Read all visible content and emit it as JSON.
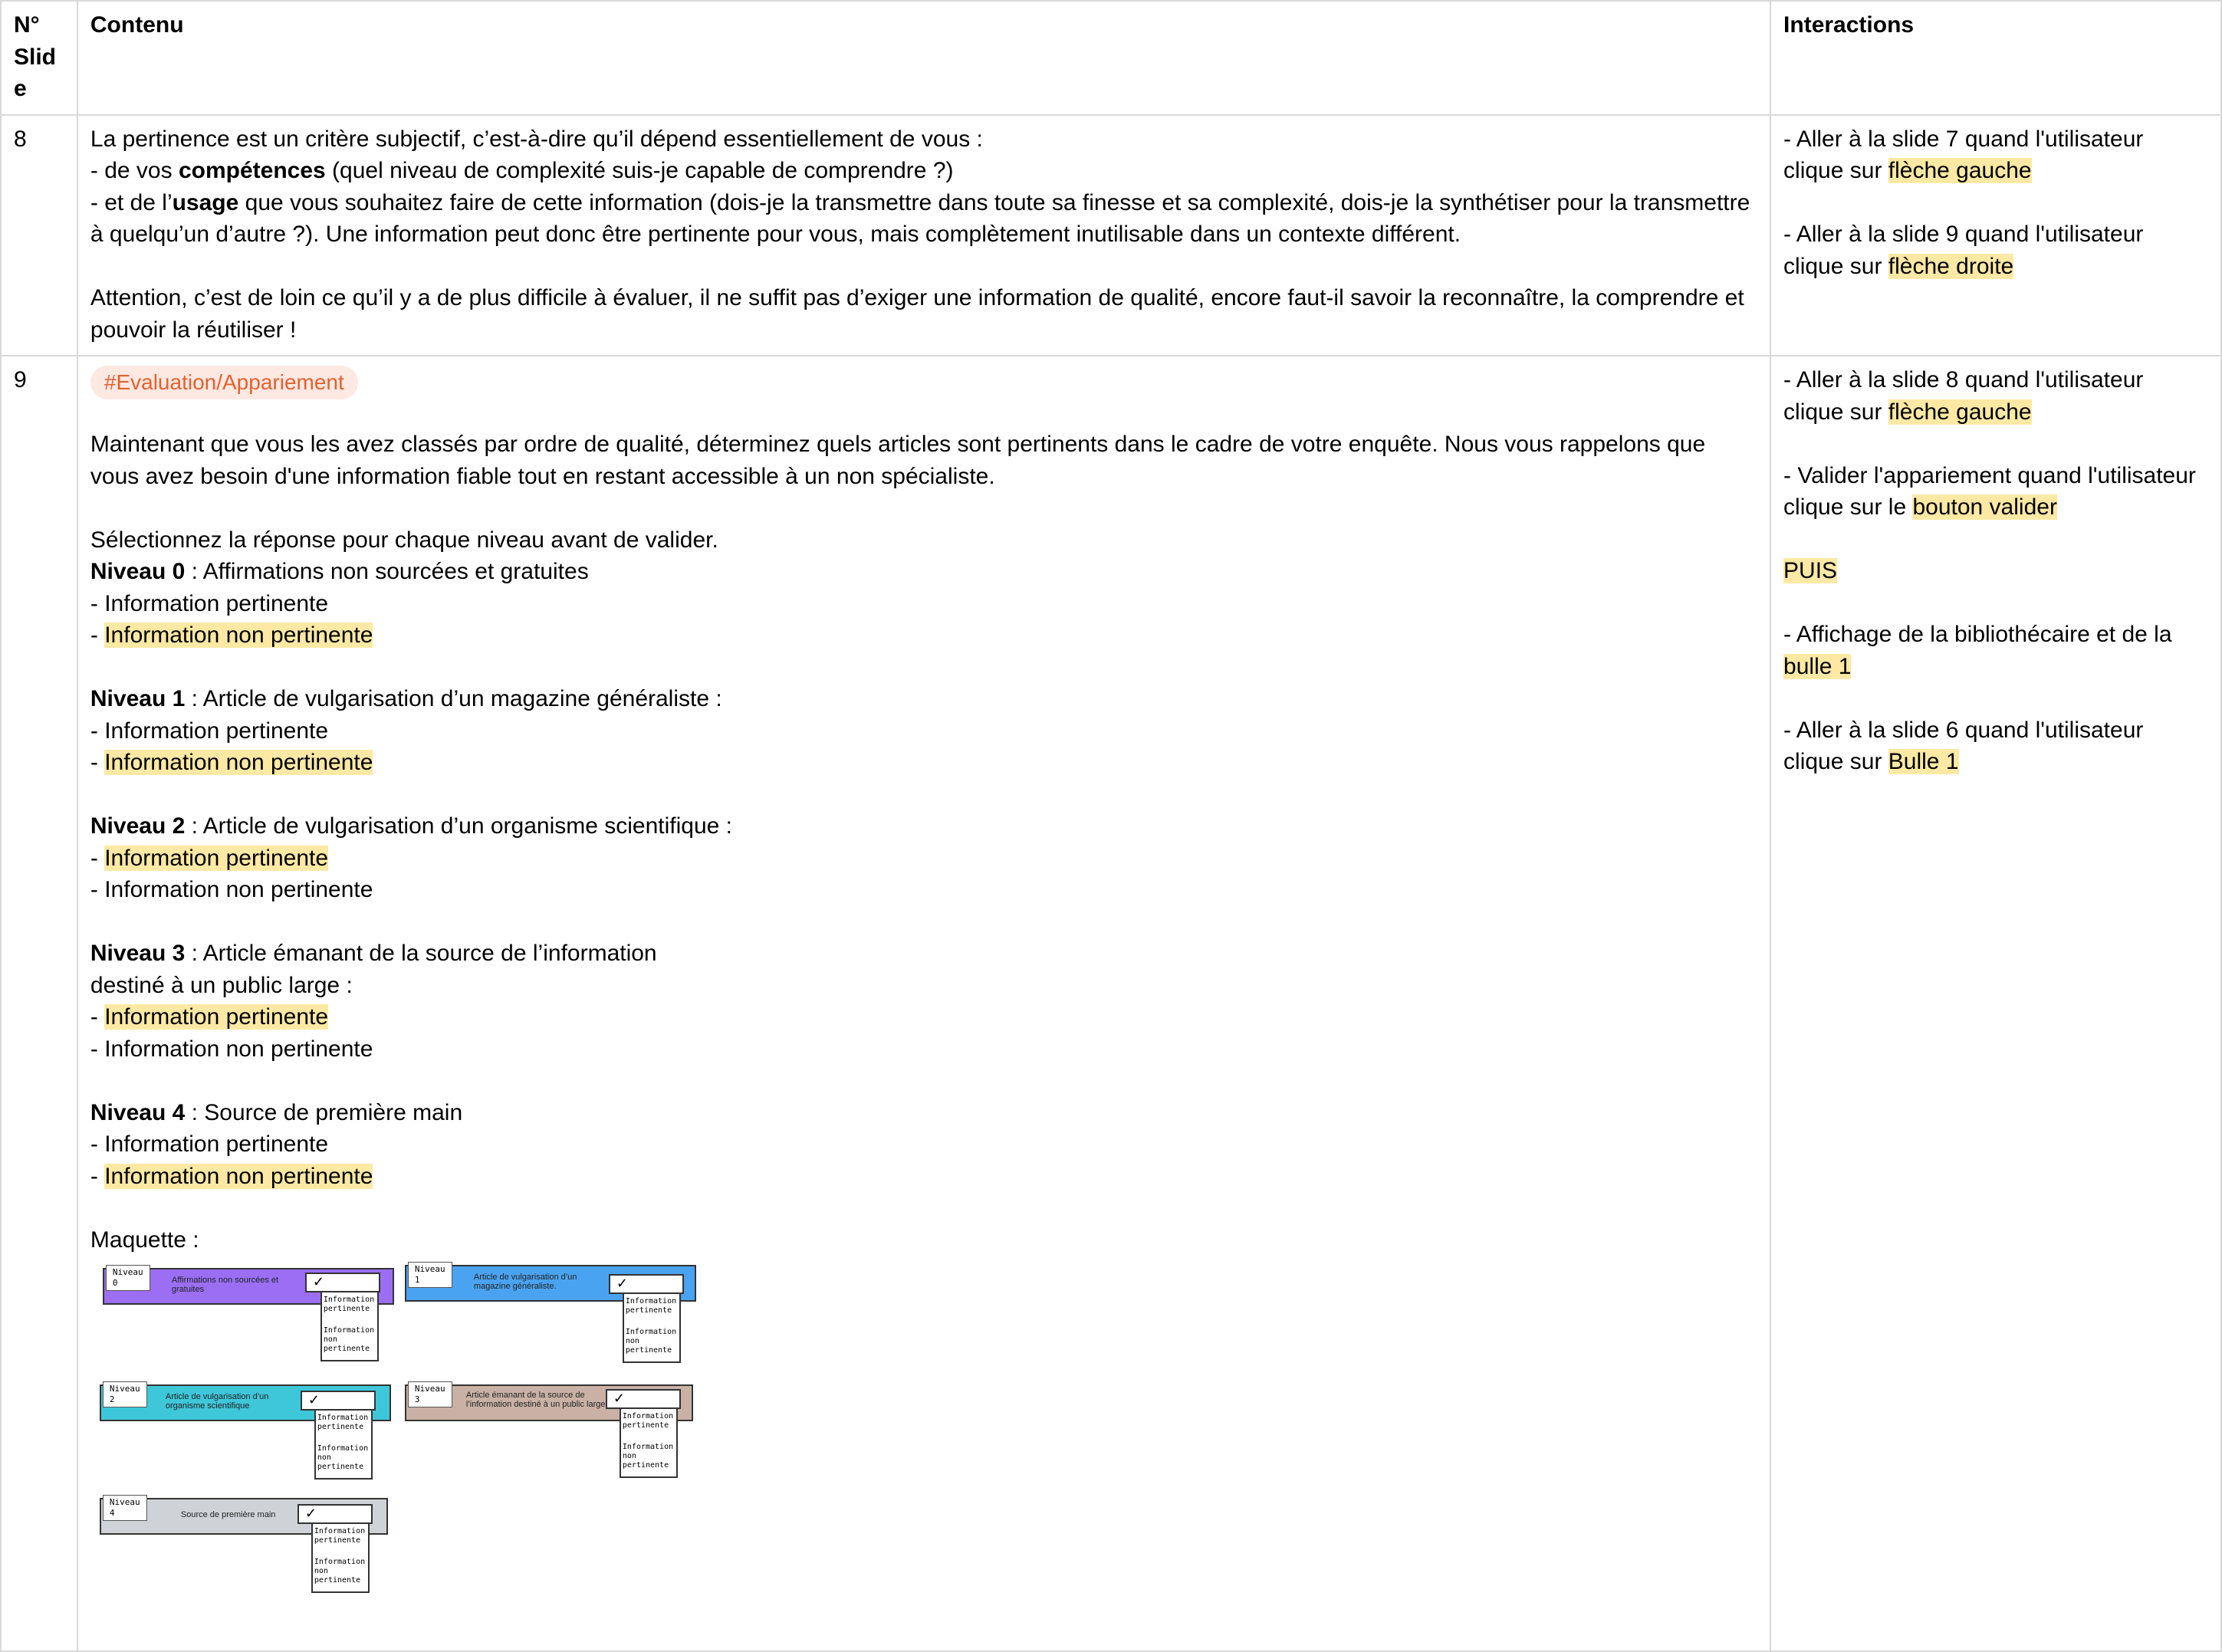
{
  "table": {
    "headers": {
      "slide": "N° Slide",
      "contenu": "Contenu",
      "interactions": "Interactions"
    },
    "rows": [
      {
        "slide": "8",
        "contenu": {
          "intro": "La pertinence est un critère subjectif, c’est-à-dire qu’il dépend essentiellement de vous :",
          "comp_pre": "- de vos ",
          "comp_bold": "compétences",
          "comp_post": " (quel niveau de complexité suis-je capable de comprendre ?)",
          "usage_pre": "- et de l’",
          "usage_bold": "usage",
          "usage_post": " que vous souhaitez faire de cette information (dois-je la transmettre dans toute sa finesse et sa complexité, dois-je la synthétiser pour la transmettre à quelqu’un d’autre ?). Une information peut donc être pertinente pour vous, mais complètement inutilisable dans un contexte différent.",
          "attention": "Attention, c’est de loin ce qu’il y a de plus difficile à évaluer, il ne suffit pas d’exiger une information de qualité, encore faut-il savoir la reconnaître, la comprendre et pouvoir la réutiliser !"
        },
        "interactions": [
          {
            "pre": "- Aller à la slide 7 quand l'utilisateur clique sur ",
            "hl": "flèche gauche"
          },
          {
            "pre": "- Aller à la slide 9 quand l'utilisateur clique sur ",
            "hl": "flèche droite"
          }
        ]
      },
      {
        "slide": "9",
        "contenu": {
          "tag": "#Evaluation/Appariement",
          "para": "Maintenant que vous les avez classés par ordre de qualité, déterminez quels articles sont pertinents dans le cadre de votre enquête. Nous vous rappelons que vous avez besoin d'une information fiable tout en restant accessible à un non spécialiste.",
          "instruction": "Sélectionnez la réponse pour chaque niveau avant de valider.",
          "levels": [
            {
              "name": "Niveau 0",
              "desc": " : Affirmations non sourcées et gratuites",
              "opt1": "- Information pertinente",
              "opt2": "- Information non pertinente"
            },
            {
              "name": "Niveau 1",
              "desc": " : Article de vulgarisation d’un magazine généraliste :",
              "opt1": "- Information pertinente",
              "opt2": "- Information non pertinente"
            },
            {
              "name": "Niveau 2",
              "desc": " : Article de vulgarisation d’un organisme scientifique :",
              "opt1": "- Information pertinente",
              "opt2": "- Information non pertinente"
            },
            {
              "name": "Niveau 3",
              "desc": " : Article émanant de la source de l’information",
              "desc2": "destiné à un public large :",
              "opt1": "- Information pertinente",
              "opt2": "- Information non pertinente"
            },
            {
              "name": "Niveau 4",
              "desc": " : Source de première main",
              "opt1": "- Information pertinente",
              "opt2": "- Information non pertinente"
            }
          ],
          "dash": "- ",
          "opt_pertinente": "Information pertinente",
          "opt_non": "Information non pertinente",
          "maquette_label": "Maquette :",
          "mockup": {
            "cards": [
              {
                "level": "Niveau 0",
                "text": "Affirmations non sourcées et gratuites",
                "color": "#9b6ef3"
              },
              {
                "level": "Niveau 1",
                "text": "Article de vulgarisation d’un magazine généraliste.",
                "color": "#4aa3f0"
              },
              {
                "level": "Niveau 2",
                "text": "Article de vulgarisation d’un organisme scientifique",
                "color": "#3ec7d9"
              },
              {
                "level": "Niveau 3",
                "text": "Article émanant de la source de l’information destiné à un public large",
                "color": "#c9b1a5"
              },
              {
                "level": "Niveau 4",
                "text": "Source de première main",
                "color": "#cfd3d8"
              }
            ],
            "dropdown_opt1": "Information pertinente",
            "dropdown_opt2": "Information non pertinente"
          }
        },
        "interactions": {
          "i1_pre": "- Aller à la slide 8 quand l'utilisateur clique sur ",
          "i1_hl": "flèche gauche",
          "i2_pre": "- Valider l'appariement quand l'utilisateur clique sur le ",
          "i2_hl": "bouton valider",
          "puis": "PUIS",
          "i3_pre": "- Affichage de la bibliothécaire et de la ",
          "i3_hl": "bulle 1",
          "i4_pre": "- Aller à la slide 6 quand l'utilisateur clique sur ",
          "i4_hl": "Bulle 1"
        }
      }
    ]
  }
}
